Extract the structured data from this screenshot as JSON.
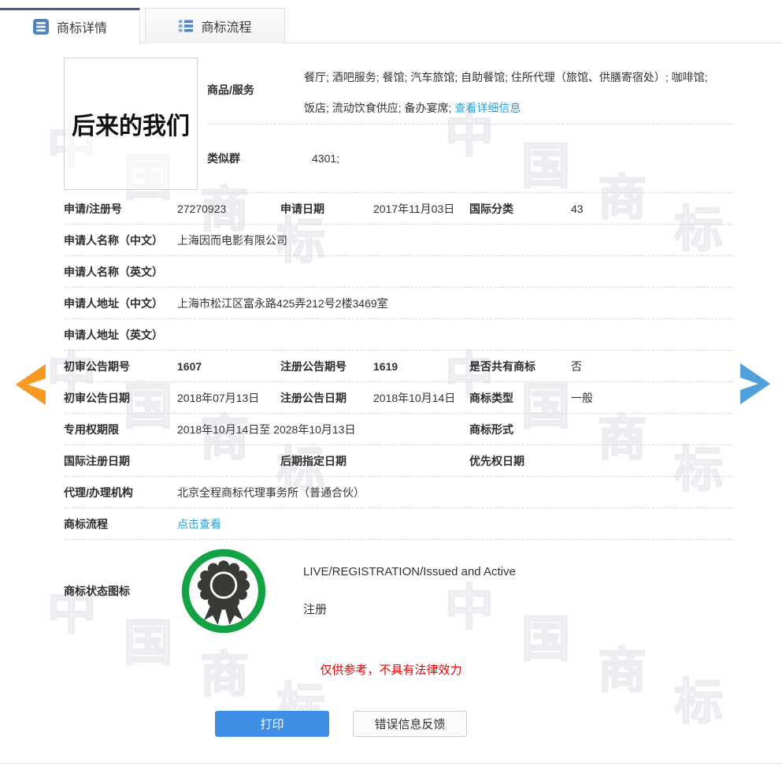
{
  "tabs": [
    {
      "label": "商标详情",
      "icon": "document-lines-icon",
      "active": true
    },
    {
      "label": "商标流程",
      "icon": "list-icon",
      "active": false
    }
  ],
  "trademark_image": {
    "text": "后来的我们"
  },
  "goods_services": {
    "label": "商品/服务",
    "value": "餐厅; 酒吧服务; 餐馆; 汽车旅馆; 自助餐馆; 住所代理（旅馆、供膳寄宿处）; 咖啡馆; 饭店; 流动饮食供应; 备办宴席;",
    "detail_link": "查看详细信息"
  },
  "similar_group": {
    "label": "类似群",
    "value": "4301;"
  },
  "fields": {
    "app_no": {
      "label": "申请/注册号",
      "value": "27270923"
    },
    "app_date": {
      "label": "申请日期",
      "value": "2017年11月03日"
    },
    "intl_class": {
      "label": "国际分类",
      "value": "43"
    },
    "applicant_cn": {
      "label": "申请人名称（中文）",
      "value": "上海因而电影有限公司"
    },
    "applicant_en": {
      "label": "申请人名称（英文）",
      "value": ""
    },
    "address_cn": {
      "label": "申请人地址（中文）",
      "value": "上海市松江区富永路425弄212号2楼3469室"
    },
    "address_en": {
      "label": "申请人地址（英文）",
      "value": ""
    },
    "first_gazette_no": {
      "label": "初审公告期号",
      "value": "1607"
    },
    "reg_gazette_no": {
      "label": "注册公告期号",
      "value": "1619"
    },
    "shared_mark": {
      "label": "是否共有商标",
      "value": "否"
    },
    "first_gazette_date": {
      "label": "初审公告日期",
      "value": "2018年07月13日"
    },
    "reg_gazette_date": {
      "label": "注册公告日期",
      "value": "2018年10月14日"
    },
    "mark_type": {
      "label": "商标类型",
      "value": "一般"
    },
    "exclusive_period": {
      "label": "专用权期限",
      "value": "2018年10月14日至 2028年10月13日"
    },
    "mark_form": {
      "label": "商标形式",
      "value": ""
    },
    "intl_reg_date": {
      "label": "国际注册日期",
      "value": ""
    },
    "later_designation": {
      "label": "后期指定日期",
      "value": ""
    },
    "priority_date": {
      "label": "优先权日期",
      "value": ""
    },
    "agency": {
      "label": "代理/办理机构",
      "value": "北京全程商标代理事务所（普通合伙）"
    },
    "process": {
      "label": "商标流程",
      "link": "点击查看"
    }
  },
  "status": {
    "label": "商标状态图标",
    "icon": "green-ribbon-badge-icon",
    "status_text": "LIVE/REGISTRATION/Issued and Active",
    "status_cn": "注册"
  },
  "disclaimer": "仅供参考，不具有法律效力",
  "actions": {
    "print": "打印",
    "feedback": "错误信息反馈"
  },
  "nav": {
    "prev_icon": "orange-left-arrow",
    "next_icon": "blue-right-arrow"
  },
  "watermark": {
    "chars": [
      "中",
      "国",
      "商",
      "标"
    ]
  },
  "colors": {
    "tab_accent": "#4e5f7e",
    "icon_blue": "#4e83c4",
    "link": "#2f9dd0",
    "print_button": "#3e8ee5",
    "disclaimer_red": "#e60000",
    "status_green": "#12a345",
    "arrow_left_orange": "#f59a23",
    "arrow_right_blue": "#52a0da"
  }
}
